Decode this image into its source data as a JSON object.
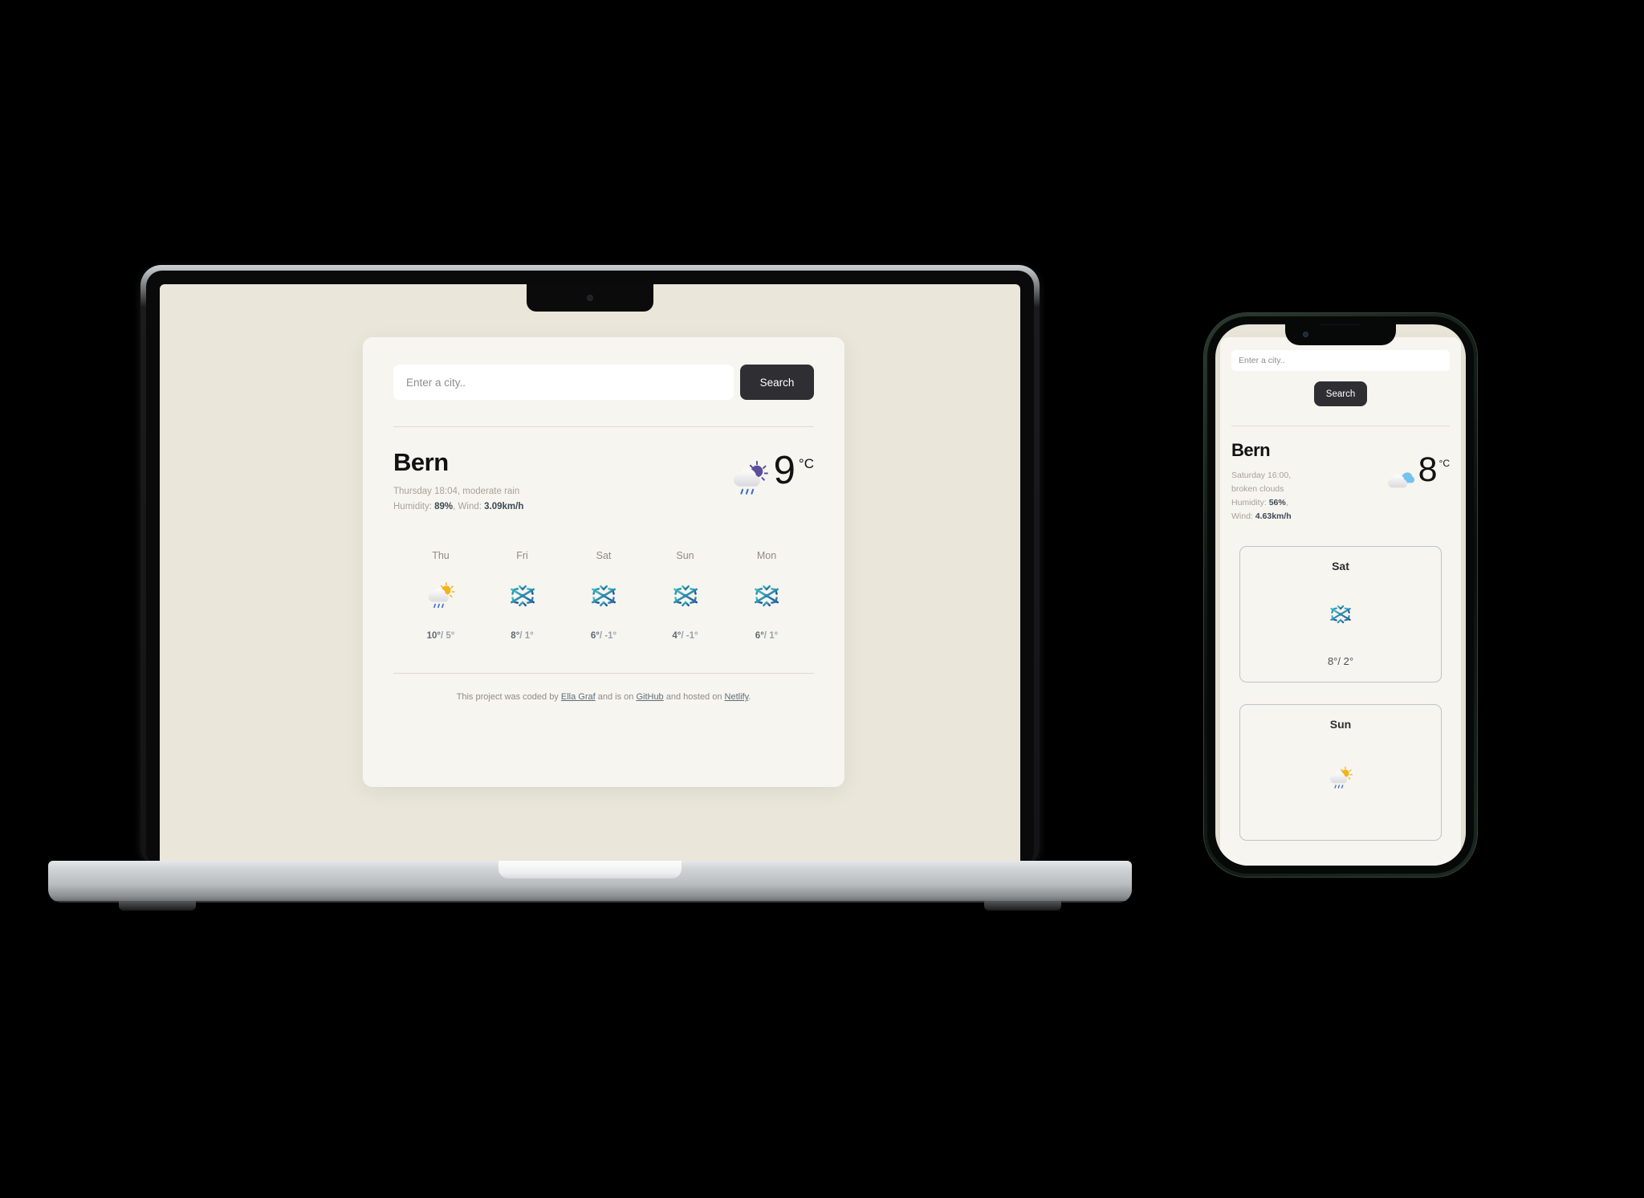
{
  "theme": {
    "screen_bg": "#eae7da",
    "card_bg": "#f7f5f0",
    "accent_dark": "#2f2f33",
    "muted_text": "#a5a29a",
    "value_text": "#3b4a55",
    "divider": "#dedbd4",
    "phone_card_border": "#b9c6c6"
  },
  "laptop": {
    "search": {
      "placeholder": "Enter a city..",
      "value": "",
      "button_label": "Search"
    },
    "current": {
      "city": "Bern",
      "datetime_desc": "Thursday 18:04, moderate rain",
      "humidity_label": "Humidity: ",
      "humidity_value": "89%",
      "comma": ", ",
      "wind_label": "Wind: ",
      "wind_value": "3.09km/h",
      "temperature": "9",
      "unit": "°C",
      "icon": "rain-with-sun-icon"
    },
    "forecast": [
      {
        "day": "Thu",
        "icon": "sun-rain-cloud-icon",
        "high": "10°",
        "sep": "/ ",
        "low": "5°"
      },
      {
        "day": "Fri",
        "icon": "snowflake-icon",
        "high": "8°",
        "sep": "/ ",
        "low": "1°"
      },
      {
        "day": "Sat",
        "icon": "snowflake-icon",
        "high": "6°",
        "sep": "/ ",
        "low": "-1°"
      },
      {
        "day": "Sun",
        "icon": "snowflake-icon",
        "high": "4°",
        "sep": "/ ",
        "low": "-1°"
      },
      {
        "day": "Mon",
        "icon": "snowflake-icon",
        "high": "6°",
        "sep": "/ ",
        "low": "1°"
      }
    ],
    "footer": {
      "part1": "This project was coded by ",
      "link1": "Ella Graf",
      "part2": " and is on ",
      "link2": "GitHub",
      "part3": " and hosted on ",
      "link3": "Netlify",
      "part4": "."
    }
  },
  "phone": {
    "search": {
      "placeholder": "Enter a city..",
      "value": "",
      "button_label": "Search"
    },
    "current": {
      "city": "Bern",
      "datetime_line1": "Saturday 16:00,",
      "datetime_line2": "broken clouds",
      "humidity_label": "Humidity: ",
      "humidity_value": "56%",
      "comma": ",",
      "wind_label": "Wind: ",
      "wind_value": "4.63km/h",
      "temperature": "8",
      "unit": "°C",
      "icon": "broken-clouds-icon"
    },
    "forecast": [
      {
        "day": "Sat",
        "icon": "snowflake-icon",
        "temps": "8°/ 2°"
      },
      {
        "day": "Sun",
        "icon": "sun-rain-cloud-icon",
        "temps": ""
      }
    ]
  }
}
